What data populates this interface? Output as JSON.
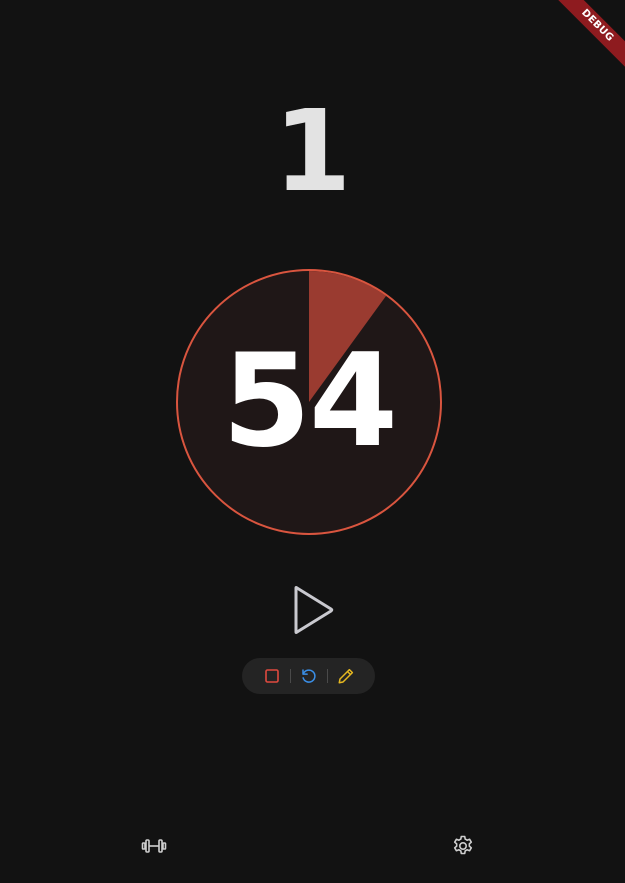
{
  "debug_banner": {
    "label": "DEBUG",
    "color": "#8e1b1f"
  },
  "round": {
    "value": "1"
  },
  "timer": {
    "value": "54",
    "progress_fraction": 0.1,
    "ring_color": "#d9553f",
    "fill_color": "#9a3b30",
    "face_color": "#1f1717"
  },
  "controls": {
    "play_icon": "play-icon",
    "stop_icon": "stop-icon",
    "reset_icon": "reset-icon",
    "edit_icon": "edit-icon",
    "stop_color": "#e04a3f",
    "reset_color": "#3a8ee6",
    "edit_color": "#e6b820"
  },
  "bottom_nav": {
    "workouts_icon": "dumbbell-icon",
    "settings_icon": "gear-icon"
  }
}
